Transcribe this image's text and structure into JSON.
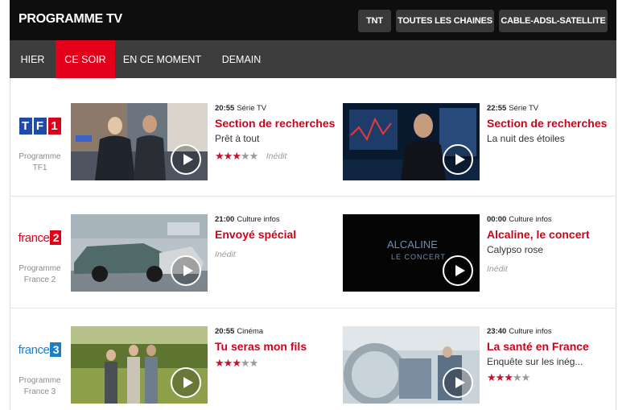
{
  "header": {
    "title": "PROGRAMME TV",
    "buttons": [
      "TNT",
      "TOUTES LES CHAINES",
      "CABLE-ADSL-SATELLITE"
    ]
  },
  "tabs": [
    {
      "label": "HIER",
      "active": false
    },
    {
      "label": "CE SOIR",
      "active": true
    },
    {
      "label": "EN CE MOMENT",
      "active": false
    },
    {
      "label": "DEMAIN",
      "active": false
    }
  ],
  "colors": {
    "accent": "#e3001b",
    "topbar": "#0e0e0e",
    "navbar": "#3d3d3d"
  },
  "channels": [
    {
      "logo": {
        "parts": [
          "T",
          "F",
          "1"
        ]
      },
      "caption_line1": "Programme",
      "caption_line2": "TF1",
      "programs": [
        {
          "time": "20:55",
          "genre": "Série TV",
          "title": "Section de recherches",
          "subtitle": "Prêt à tout",
          "stars": 2.5,
          "badge": "Inédit"
        },
        {
          "time": "22:55",
          "genre": "Série TV",
          "title": "Section de recherches",
          "subtitle": "La nuit des étoiles",
          "stars": null,
          "badge": ""
        }
      ]
    },
    {
      "logo": {
        "name": "france",
        "num": "2"
      },
      "caption_line1": "Programme",
      "caption_line2": "France 2",
      "programs": [
        {
          "time": "21:00",
          "genre": "Culture infos",
          "title": "Envoyé spécial",
          "subtitle": "",
          "stars": null,
          "badge": "Inédit"
        },
        {
          "time": "00:00",
          "genre": "Culture infos",
          "title": "Alcaline, le concert",
          "subtitle": "Calypso rose",
          "stars": null,
          "badge": "Inédit",
          "thumb_text1": "ALCALINE",
          "thumb_text2": "LE CONCERT"
        }
      ]
    },
    {
      "logo": {
        "name": "france",
        "num": "3"
      },
      "caption_line1": "Programme",
      "caption_line2": "France 3",
      "programs": [
        {
          "time": "20:55",
          "genre": "Cinéma",
          "title": "Tu seras mon fils",
          "subtitle": "",
          "stars": 2.5,
          "badge": ""
        },
        {
          "time": "23:40",
          "genre": "Culture infos",
          "title": "La santé en France",
          "subtitle": "Enquête sur les inég...",
          "stars": 2.5,
          "badge": ""
        }
      ]
    }
  ]
}
